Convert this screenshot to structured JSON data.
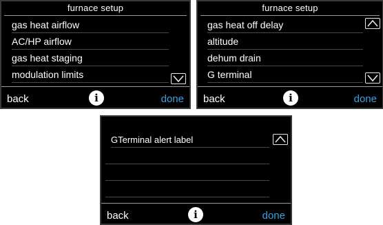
{
  "screen_a": {
    "title": "furnace setup",
    "items": [
      {
        "label": "gas heat airflow"
      },
      {
        "label": "AC/HP airflow"
      },
      {
        "label": "gas heat staging"
      },
      {
        "label": "modulation limits"
      }
    ],
    "scroll_down_icon": "chevron-down-icon",
    "footer": {
      "back_label": "back",
      "info_label": "i",
      "done_label": "done"
    }
  },
  "screen_b": {
    "title": "furnace setup",
    "items": [
      {
        "label": "gas heat off delay"
      },
      {
        "label": "altitude"
      },
      {
        "label": "dehum drain"
      },
      {
        "label": "G terminal"
      }
    ],
    "scroll_up_icon": "chevron-up-icon",
    "scroll_down_icon": "chevron-down-icon",
    "footer": {
      "back_label": "back",
      "info_label": "i",
      "done_label": "done"
    }
  },
  "screen_c": {
    "items": [
      {
        "label": "GTerminal alert label"
      }
    ],
    "scroll_up_icon": "chevron-up-icon",
    "footer": {
      "back_label": "back",
      "info_label": "i",
      "done_label": "done"
    }
  },
  "colors": {
    "screen_background": "#000000",
    "text": "#ffffff",
    "done_accent": "#3aa0e0",
    "divider": "#4a4a4a"
  }
}
